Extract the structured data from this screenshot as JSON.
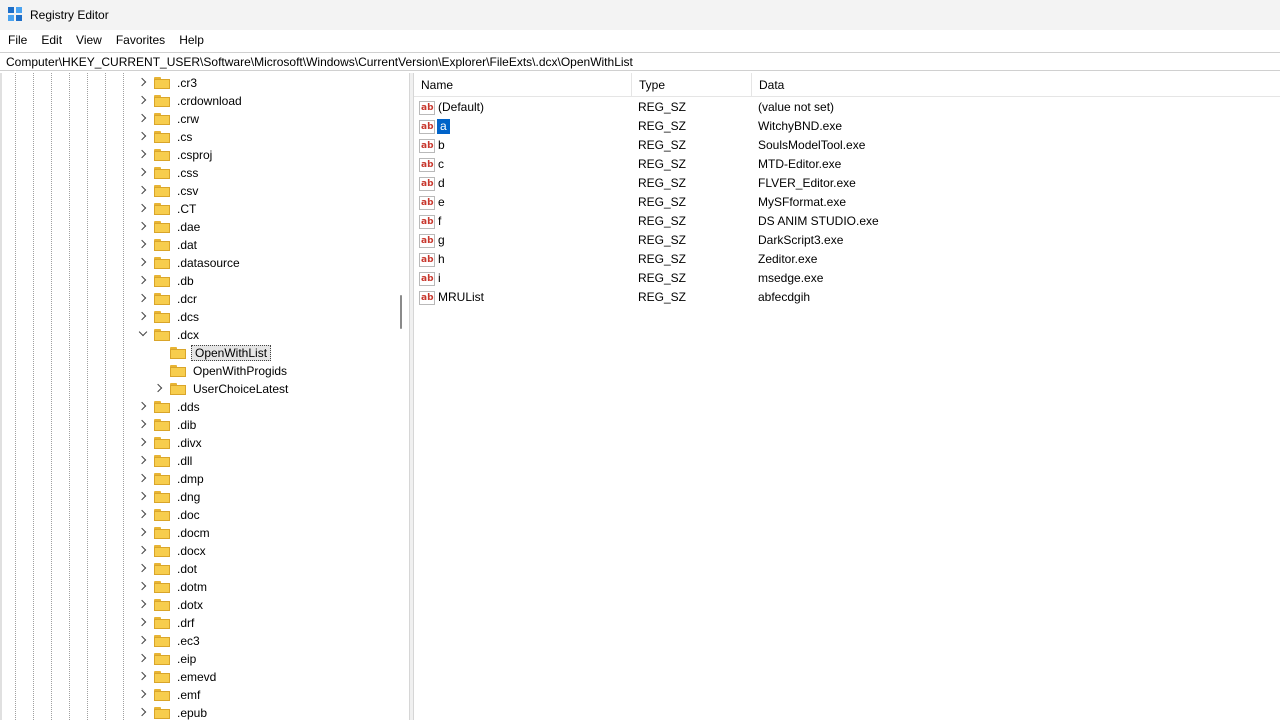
{
  "window": {
    "title": "Registry Editor"
  },
  "menu": [
    "File",
    "Edit",
    "View",
    "Favorites",
    "Help"
  ],
  "address": {
    "path": "Computer\\HKEY_CURRENT_USER\\Software\\Microsoft\\Windows\\CurrentVersion\\Explorer\\FileExts\\.dcx\\OpenWithList"
  },
  "tree": {
    "items": [
      {
        "label": ".cr3",
        "expander": "right",
        "level": 0
      },
      {
        "label": ".crdownload",
        "expander": "right",
        "level": 0
      },
      {
        "label": ".crw",
        "expander": "right",
        "level": 0
      },
      {
        "label": ".cs",
        "expander": "right",
        "level": 0
      },
      {
        "label": ".csproj",
        "expander": "right",
        "level": 0
      },
      {
        "label": ".css",
        "expander": "right",
        "level": 0
      },
      {
        "label": ".csv",
        "expander": "right",
        "level": 0
      },
      {
        "label": ".CT",
        "expander": "right",
        "level": 0
      },
      {
        "label": ".dae",
        "expander": "right",
        "level": 0
      },
      {
        "label": ".dat",
        "expander": "right",
        "level": 0
      },
      {
        "label": ".datasource",
        "expander": "right",
        "level": 0
      },
      {
        "label": ".db",
        "expander": "right",
        "level": 0
      },
      {
        "label": ".dcr",
        "expander": "right",
        "level": 0
      },
      {
        "label": ".dcs",
        "expander": "right",
        "level": 0
      },
      {
        "label": ".dcx",
        "expander": "down",
        "level": 0
      },
      {
        "label": "OpenWithList",
        "expander": "none",
        "level": 1,
        "selected": true
      },
      {
        "label": "OpenWithProgids",
        "expander": "none",
        "level": 1
      },
      {
        "label": "UserChoiceLatest",
        "expander": "right",
        "level": 1
      },
      {
        "label": ".dds",
        "expander": "right",
        "level": 0
      },
      {
        "label": ".dib",
        "expander": "right",
        "level": 0
      },
      {
        "label": ".divx",
        "expander": "right",
        "level": 0
      },
      {
        "label": ".dll",
        "expander": "right",
        "level": 0
      },
      {
        "label": ".dmp",
        "expander": "right",
        "level": 0
      },
      {
        "label": ".dng",
        "expander": "right",
        "level": 0
      },
      {
        "label": ".doc",
        "expander": "right",
        "level": 0
      },
      {
        "label": ".docm",
        "expander": "right",
        "level": 0
      },
      {
        "label": ".docx",
        "expander": "right",
        "level": 0
      },
      {
        "label": ".dot",
        "expander": "right",
        "level": 0
      },
      {
        "label": ".dotm",
        "expander": "right",
        "level": 0
      },
      {
        "label": ".dotx",
        "expander": "right",
        "level": 0
      },
      {
        "label": ".drf",
        "expander": "right",
        "level": 0
      },
      {
        "label": ".ec3",
        "expander": "right",
        "level": 0
      },
      {
        "label": ".eip",
        "expander": "right",
        "level": 0
      },
      {
        "label": ".emevd",
        "expander": "right",
        "level": 0
      },
      {
        "label": ".emf",
        "expander": "right",
        "level": 0
      },
      {
        "label": ".epub",
        "expander": "right",
        "level": 0
      }
    ]
  },
  "list": {
    "columns": {
      "name": "Name",
      "type": "Type",
      "data": "Data"
    },
    "rows": [
      {
        "name": "(Default)",
        "type": "REG_SZ",
        "data": "(value not set)"
      },
      {
        "name": "a",
        "type": "REG_SZ",
        "data": "WitchyBND.exe",
        "selected": true
      },
      {
        "name": "b",
        "type": "REG_SZ",
        "data": "SoulsModelTool.exe"
      },
      {
        "name": "c",
        "type": "REG_SZ",
        "data": "MTD-Editor.exe"
      },
      {
        "name": "d",
        "type": "REG_SZ",
        "data": "FLVER_Editor.exe"
      },
      {
        "name": "e",
        "type": "REG_SZ",
        "data": "MySFformat.exe"
      },
      {
        "name": "f",
        "type": "REG_SZ",
        "data": "DS ANIM STUDIO.exe"
      },
      {
        "name": "g",
        "type": "REG_SZ",
        "data": "DarkScript3.exe"
      },
      {
        "name": "h",
        "type": "REG_SZ",
        "data": "Zeditor.exe"
      },
      {
        "name": "i",
        "type": "REG_SZ",
        "data": "msedge.exe"
      },
      {
        "name": "MRUList",
        "type": "REG_SZ",
        "data": "abfecdgih"
      }
    ],
    "value_icon": {
      "name": "string-value-icon",
      "glyph": "ab"
    }
  },
  "colors": {
    "selection": "#0063c9",
    "folder": "#f7cd4d",
    "ab_icon": "#c8372d"
  }
}
